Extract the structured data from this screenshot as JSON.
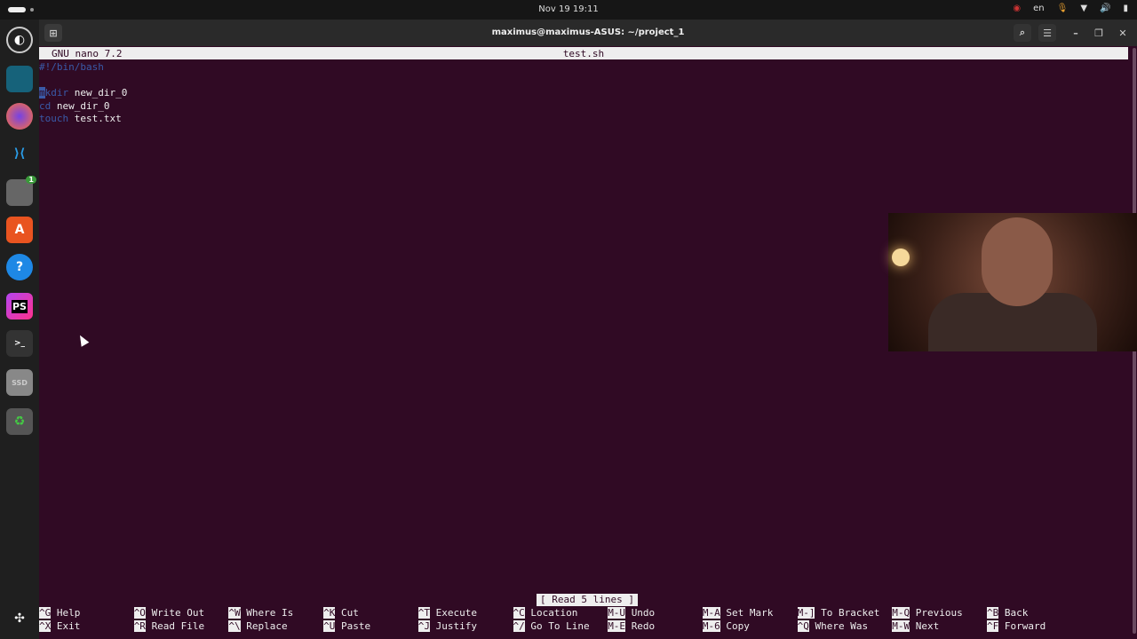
{
  "topbar": {
    "clock": "Nov 19  19:11",
    "lang": "en"
  },
  "window": {
    "title": "maximus@maximus-ASUS: ~/project_1"
  },
  "nano": {
    "version": "GNU nano 7.2",
    "filename": "test.sh",
    "status": "[ Read 5 lines ]",
    "lines": [
      {
        "kw": "#!/bin/bash",
        "rest": ""
      },
      {
        "kw": "",
        "rest": ""
      },
      {
        "kw": "mkdir",
        "rest": " new_dir_0"
      },
      {
        "kw": "cd",
        "rest": " new_dir_0"
      },
      {
        "kw": "touch",
        "rest": " test.txt"
      }
    ],
    "shortcuts": [
      [
        {
          "k": "^G",
          "l": "Help"
        },
        {
          "k": "^X",
          "l": "Exit"
        }
      ],
      [
        {
          "k": "^O",
          "l": "Write Out"
        },
        {
          "k": "^R",
          "l": "Read File"
        }
      ],
      [
        {
          "k": "^W",
          "l": "Where Is"
        },
        {
          "k": "^\\",
          "l": "Replace"
        }
      ],
      [
        {
          "k": "^K",
          "l": "Cut"
        },
        {
          "k": "^U",
          "l": "Paste"
        }
      ],
      [
        {
          "k": "^T",
          "l": "Execute"
        },
        {
          "k": "^J",
          "l": "Justify"
        }
      ],
      [
        {
          "k": "^C",
          "l": "Location"
        },
        {
          "k": "^/",
          "l": "Go To Line"
        }
      ],
      [
        {
          "k": "M-U",
          "l": "Undo"
        },
        {
          "k": "M-E",
          "l": "Redo"
        }
      ],
      [
        {
          "k": "M-A",
          "l": "Set Mark"
        },
        {
          "k": "M-6",
          "l": "Copy"
        }
      ],
      [
        {
          "k": "M-]",
          "l": "To Bracket"
        },
        {
          "k": "^Q",
          "l": "Where Was"
        }
      ],
      [
        {
          "k": "M-Q",
          "l": "Previous"
        },
        {
          "k": "M-W",
          "l": "Next"
        }
      ],
      [
        {
          "k": "^B",
          "l": "Back"
        },
        {
          "k": "^F",
          "l": "Forward"
        }
      ]
    ]
  },
  "dock": {
    "files_badge": "1",
    "phpstorm": "PS",
    "ssd": "SSD"
  }
}
